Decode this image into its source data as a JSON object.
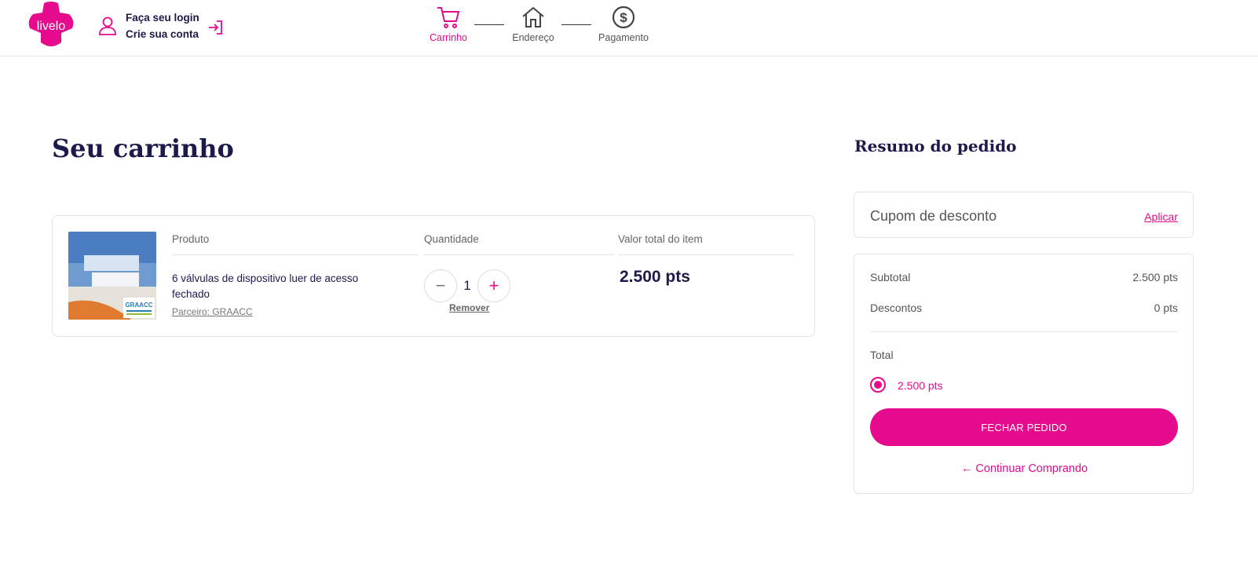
{
  "brand": {
    "logo_text": "livelo",
    "accent": "#e60a8c",
    "navy": "#1c1a4b"
  },
  "header": {
    "login_label": "Faça seu login",
    "signup_label": "Crie sua conta",
    "steps": [
      {
        "label": "Carrinho",
        "icon": "cart-icon",
        "active": true
      },
      {
        "label": "Endereço",
        "icon": "home-icon",
        "active": false
      },
      {
        "label": "Pagamento",
        "icon": "dollar-icon",
        "active": false
      }
    ]
  },
  "cart": {
    "title": "Seu carrinho",
    "columns": {
      "product": "Produto",
      "quantity": "Quantidade",
      "item_total": "Valor total do item"
    },
    "item": {
      "name": "6 válvulas de dispositivo luer de acesso fechado",
      "partner": "Parceiro: GRAACC",
      "quantity": "1",
      "remove_label": "Remover",
      "total": "2.500 pts",
      "image_badge": "GRAACC"
    }
  },
  "summary": {
    "title": "Resumo do pedido",
    "coupon_label": "Cupom de desconto",
    "coupon_apply": "Aplicar",
    "subtotal_label": "Subtotal",
    "subtotal_value": "2.500 pts",
    "discounts_label": "Descontos",
    "discounts_value": "0 pts",
    "total_label": "Total",
    "total_option": "2.500 pts",
    "close_order_label": "FECHAR PEDIDO",
    "continue_label": "← Continuar Comprando"
  }
}
